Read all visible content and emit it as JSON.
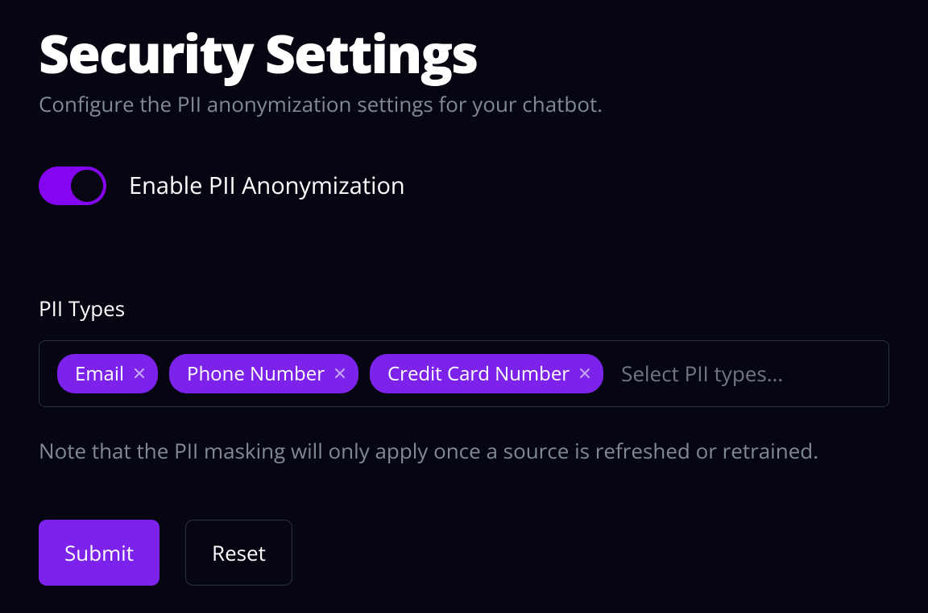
{
  "header": {
    "title": "Security Settings",
    "subtitle": "Configure the PII anonymization settings for your chatbot."
  },
  "toggle": {
    "enabled": true,
    "label": "Enable PII Anonymization"
  },
  "pii_types": {
    "label": "PII Types",
    "selected": [
      {
        "label": "Email"
      },
      {
        "label": "Phone Number"
      },
      {
        "label": "Credit Card Number"
      }
    ],
    "placeholder": "Select PII types..."
  },
  "note": "Note that the PII masking will only apply once a source is refreshed or retrained.",
  "actions": {
    "submit": "Submit",
    "reset": "Reset"
  },
  "colors": {
    "accent": "#7c22eb",
    "toggle_accent": "#8605f0",
    "background": "#060612",
    "muted_text": "#808a97",
    "border": "#2e3138"
  }
}
